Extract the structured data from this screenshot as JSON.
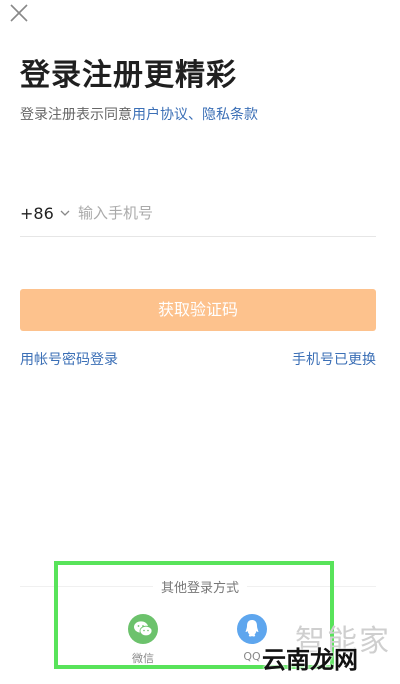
{
  "page": {
    "title": "登录注册更精彩",
    "agreement_prefix": "登录注册表示同意",
    "user_agreement": "用户协议",
    "separator": "、",
    "privacy_policy": "隐私条款"
  },
  "phone": {
    "country_code": "+86",
    "placeholder": "输入手机号",
    "value": ""
  },
  "buttons": {
    "get_code": "获取验证码",
    "password_login": "用帐号密码登录",
    "phone_changed": "手机号已更换"
  },
  "other_login": {
    "label": "其他登录方式",
    "options": [
      {
        "label": "微信",
        "icon": "wechat-icon",
        "color": "#6cc26c"
      },
      {
        "label": "QQ",
        "icon": "qq-icon",
        "color": "#5ea6ee"
      }
    ]
  },
  "watermark": {
    "site": "云南龙网",
    "brand": "智能家"
  },
  "colors": {
    "accent_button": "#fdc28d",
    "link": "#3b6fb6",
    "highlight": "#58e35a"
  }
}
